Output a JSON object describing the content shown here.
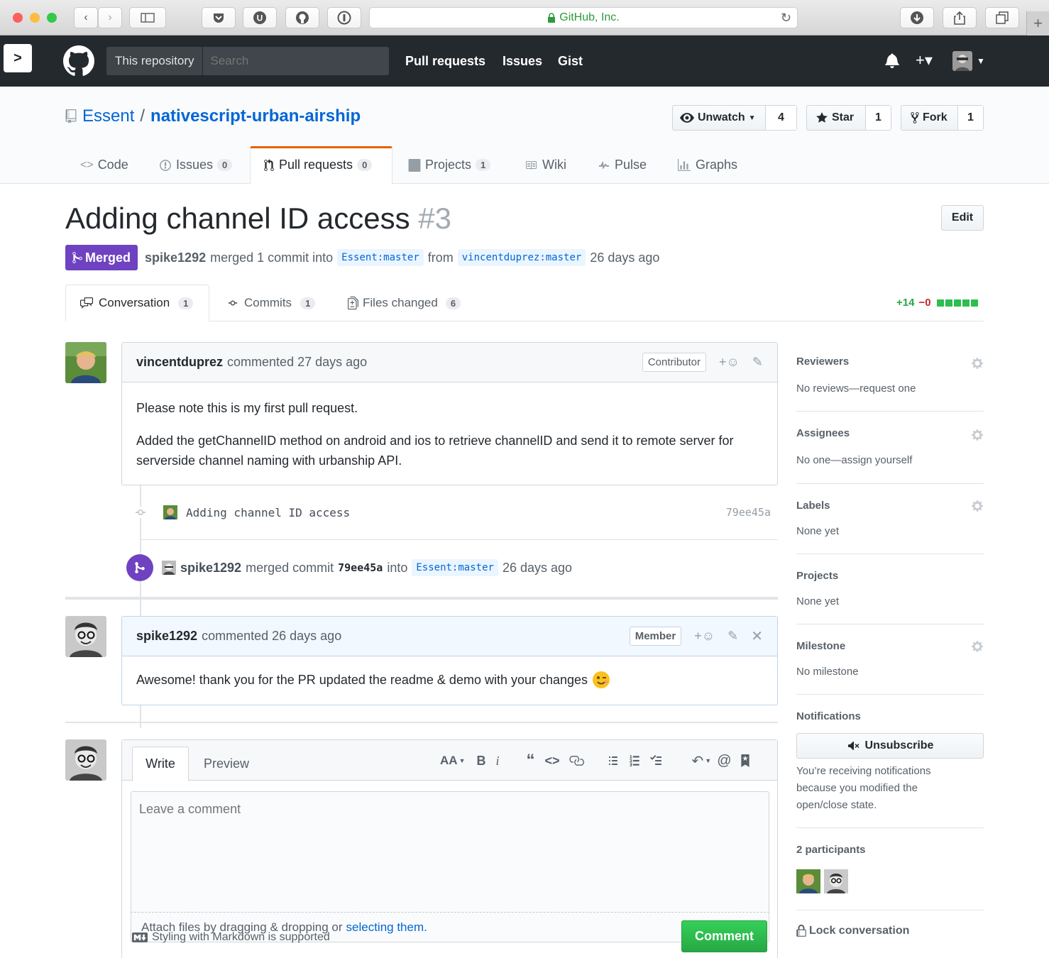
{
  "browser": {
    "url_label": "GitHub, Inc.",
    "sidebar_toggle": ">"
  },
  "header": {
    "scope_label": "This repository",
    "search_placeholder": "Search",
    "nav": [
      "Pull requests",
      "Issues",
      "Gist"
    ],
    "plus_label": "+▾"
  },
  "repo": {
    "owner": "Essent",
    "separator": "/",
    "name": "nativescript-urban-airship",
    "unwatch_label": "Unwatch",
    "watch_count": "4",
    "star_label": "Star",
    "star_count": "1",
    "fork_label": "Fork",
    "fork_count": "1",
    "tabs": [
      {
        "label": "Code",
        "count": ""
      },
      {
        "label": "Issues",
        "count": "0"
      },
      {
        "label": "Pull requests",
        "count": "0"
      },
      {
        "label": "Projects",
        "count": "1"
      },
      {
        "label": "Wiki",
        "count": ""
      },
      {
        "label": "Pulse",
        "count": ""
      },
      {
        "label": "Graphs",
        "count": ""
      }
    ]
  },
  "pr": {
    "title": "Adding channel ID access",
    "number": "#3",
    "edit_label": "Edit",
    "state": "Merged",
    "author": "spike1292",
    "merge_text": "merged 1 commit into",
    "base_ref": "Essent:master",
    "from_text": "from",
    "head_ref": "vincentduprez:master",
    "age": "26 days ago",
    "tabs": [
      {
        "label": "Conversation",
        "count": "1"
      },
      {
        "label": "Commits",
        "count": "1"
      },
      {
        "label": "Files changed",
        "count": "6"
      }
    ],
    "additions": "+14",
    "deletions": "−0"
  },
  "comments": [
    {
      "author": "vincentduprez",
      "meta": "commented 27 days ago",
      "role": "Contributor",
      "body": [
        "Please note this is my first pull request.",
        "Added the getChannelID method on android and ios to retrieve channelID and send it to remote server for serverside channel naming with urbanship API."
      ]
    },
    {
      "author": "spike1292",
      "meta": "commented 26 days ago",
      "role": "Member",
      "body": [
        "Awesome! thank you for the PR updated the readme & demo with your changes"
      ]
    }
  ],
  "commit": {
    "message": "Adding channel ID access",
    "sha": "79ee45a"
  },
  "merge_event": {
    "author": "spike1292",
    "text": "merged commit",
    "sha": "79ee45a",
    "into": "into",
    "ref": "Essent:master",
    "age": "26 days ago"
  },
  "composer": {
    "tab_write": "Write",
    "tab_preview": "Preview",
    "placeholder": "Leave a comment",
    "attach_text": "Attach files by dragging & dropping or",
    "attach_link": "selecting them.",
    "markdown_note": "Styling with Markdown is supported",
    "submit_label": "Comment",
    "toolbar": {
      "header": "AA",
      "bold": "B",
      "italic": "i"
    }
  },
  "sidebar": {
    "reviewers": {
      "title": "Reviewers",
      "value": "No reviews—request one"
    },
    "assignees": {
      "title": "Assignees",
      "value": "No one—assign yourself"
    },
    "labels": {
      "title": "Labels",
      "value": "None yet"
    },
    "projects": {
      "title": "Projects",
      "value": "None yet"
    },
    "milestone": {
      "title": "Milestone",
      "value": "No milestone"
    },
    "notifications": {
      "title": "Notifications",
      "button": "Unsubscribe",
      "reason": "You’re receiving notifications because you modified the open/close state."
    },
    "participants": {
      "title": "2 participants"
    },
    "lock": {
      "label": "Lock conversation"
    }
  },
  "colors": {
    "merged": "#6f42c1",
    "link": "#0366d6",
    "green": "#28a745",
    "red": "#cb2431"
  }
}
